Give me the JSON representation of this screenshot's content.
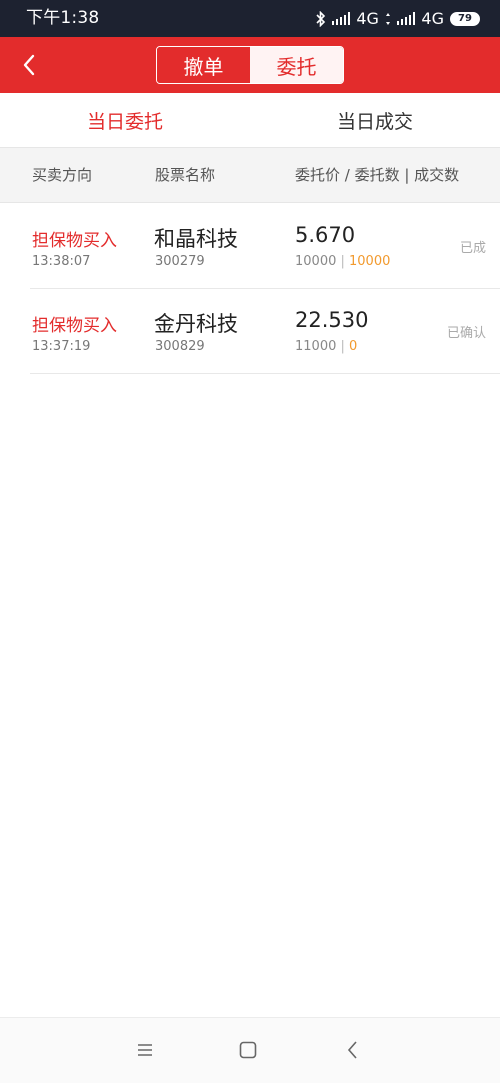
{
  "status_bar": {
    "time": "下午1:38",
    "network_1": "4G",
    "network_2": "4G",
    "battery": "79"
  },
  "header": {
    "segments": [
      {
        "label": "撤单",
        "active": false
      },
      {
        "label": "委托",
        "active": true
      }
    ],
    "accent_color": "#e32c2c"
  },
  "tabs": [
    {
      "label": "当日委托",
      "active": true
    },
    {
      "label": "当日成交",
      "active": false
    }
  ],
  "columns": {
    "direction": "买卖方向",
    "stock_name": "股票名称",
    "price_qty": "委托价 / 委托数 | 成交数"
  },
  "orders": [
    {
      "direction": "担保物买入",
      "time": "13:38:07",
      "name": "和晶科技",
      "code": "300279",
      "price": "5.670",
      "order_qty": "10000",
      "separator": " | ",
      "deal_qty": "10000",
      "status": "已成"
    },
    {
      "direction": "担保物买入",
      "time": "13:37:19",
      "name": "金丹科技",
      "code": "300829",
      "price": "22.530",
      "order_qty": "11000",
      "separator": " | ",
      "deal_qty": "0",
      "status": "已确认"
    }
  ],
  "nav_icons": [
    "menu-icon",
    "home-square-icon",
    "back-triangle-icon"
  ]
}
